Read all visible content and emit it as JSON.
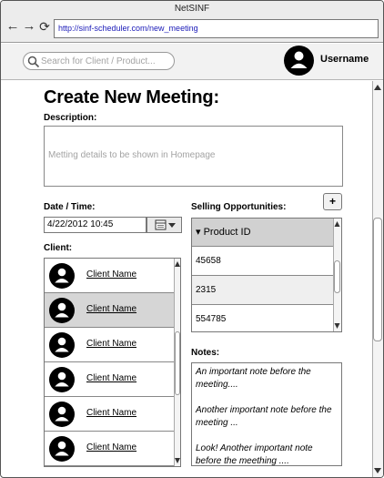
{
  "browser": {
    "title": "NetSINF",
    "url": "http://sinf-scheduler.com/new_meeting",
    "back_glyph": "←",
    "forward_glyph": "→",
    "reload_glyph": "⟳"
  },
  "header": {
    "search_placeholder": "Search for Client / Product...",
    "username": "Username"
  },
  "page": {
    "title": "Create New Meeting:",
    "description_label": "Description:",
    "description_placeholder": "Metting details to be shown in Homepage",
    "datetime_label": "Date / Time:",
    "datetime_value": "4/22/2012  10:45",
    "client_label": "Client:",
    "clients": [
      {
        "name": "Client Name",
        "selected": false
      },
      {
        "name": "Client Name",
        "selected": true
      },
      {
        "name": "Client Name",
        "selected": false
      },
      {
        "name": "Client Name",
        "selected": false
      },
      {
        "name": "Client Name",
        "selected": false
      },
      {
        "name": "Client Name",
        "selected": false
      }
    ],
    "selling_label": "Selling Opportunities:",
    "add_button": "+",
    "selling_column": "▾ Product ID",
    "products": [
      "45658",
      "2315",
      "554785"
    ],
    "notes_label": "Notes:",
    "notes": [
      "An important note before the meeting....",
      "Another important note before the meeting ...",
      "Look! Another important note before the meething ...."
    ]
  },
  "colors": {
    "selected_row": "#d6d6d6",
    "url_text": "#1a1ab8",
    "placeholder": "#a3a3a3"
  }
}
